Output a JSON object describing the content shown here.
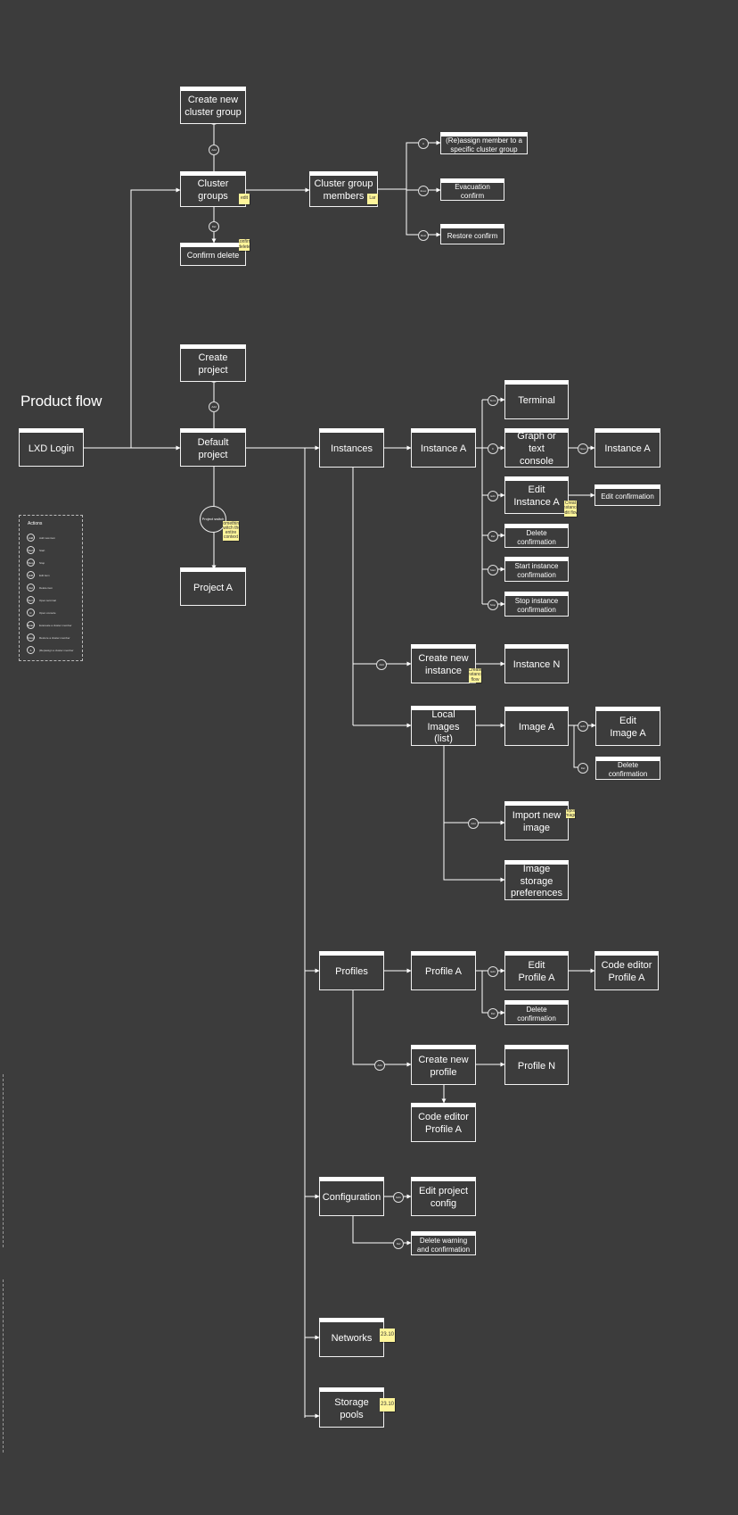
{
  "title": "Product flow",
  "nodes": {
    "create_cluster_group": "Create new\ncluster group",
    "cluster_groups": "Cluster\ngroups",
    "confirm_delete": "Confirm delete",
    "cluster_group_members": "Cluster group\nmembers",
    "reassign_member": "(Re)assign member to a\nspecific cluster group",
    "evacuation_confirm": "Evacuation confirm",
    "restore_confirm": "Restore confirm",
    "create_project": "Create\nproject",
    "lxd_login": "LXD Login",
    "default_project": "Default\nproject",
    "project_a": "Project A",
    "instances": "Instances",
    "instance_a": "Instance A",
    "terminal": "Terminal",
    "graph_console": "Graph or text\nconsole",
    "instance_a_console": "Instance A",
    "edit_instance_a": "Edit\nInstance A",
    "edit_confirmation": "Edit confirmation",
    "delete_confirmation_instance": "Delete confirmation",
    "start_instance_confirmation": "Start instance\nconfirmation",
    "stop_instance_confirmation": "Stop instance\nconfirmation",
    "create_new_instance": "Create new\ninstance",
    "instance_n": "Instance N",
    "local_images": "Local Images\n(list)",
    "image_a": "Image A",
    "edit_image_a": "Edit\nImage A",
    "delete_confirmation_image": "Delete confirmation",
    "import_new_image": "Import new\nimage",
    "image_storage_preferences": "Image storage\npreferences",
    "profiles": "Profiles",
    "profile_a": "Profile A",
    "edit_profile_a": "Edit\nProfile A",
    "code_editor_profile_a": "Code editor\nProfile A",
    "delete_confirmation_profile": "Delete confirmation",
    "create_new_profile": "Create new\nprofile",
    "profile_n": "Profile N",
    "code_editor_profile_a_2": "Code editor\nProfile A",
    "configuration": "Configuration",
    "edit_project_config": "Edit project\nconfig",
    "delete_warning": "Delete warning\nand confirmation",
    "networks": "Networks",
    "storage_pools": "Storage\npools"
  },
  "project_switch_label": "Project\nswitch",
  "stickies": {
    "cluster_groups": "edit",
    "confirm_delete": "Confirm\ndelete",
    "cluster_group_members": "Lar",
    "project_switch": "Something\nswitch the\nentire\ncontext",
    "edit_instance_a": "Creat\ninstance\nedit\nflow",
    "create_new_instance": "Create\ninstance\nflow",
    "import_new_image": "Import\nimage",
    "networks": "23.10",
    "storage_pools": "23.10"
  },
  "badges": {
    "to_create_cluster_group": "Add",
    "to_confirm_delete": "Del",
    "to_reassign": "A",
    "to_evacuate": "Evac",
    "to_restore": "Rest",
    "to_create_project": "Add",
    "to_terminal": "Term",
    "to_graph_console": "C",
    "to_instance_console": "Open",
    "to_edit_instance": "Edit",
    "to_delete_instance": "Del",
    "to_start_instance": "Start",
    "to_stop_instance": "Stop",
    "to_create_instance": "Add",
    "to_edit_image": "Edit",
    "to_delete_image": "Del",
    "to_import_image": "Add",
    "to_edit_profile": "Edit",
    "to_delete_profile": "Del",
    "to_create_profile": "Add",
    "to_edit_config": "Edit",
    "to_delete_config": "Del"
  },
  "legend": {
    "title": "Actions",
    "items": [
      {
        "icon": "Add",
        "label": "Add new item"
      },
      {
        "icon": "Start",
        "label": "Start"
      },
      {
        "icon": "Stop",
        "label": "Stop"
      },
      {
        "icon": "Edit",
        "label": "Edit item"
      },
      {
        "icon": "Del",
        "label": "Delete item"
      },
      {
        "icon": "Term",
        "label": "Open terminal"
      },
      {
        "icon": "C",
        "label": "Open console"
      },
      {
        "icon": "Evac",
        "label": "Evacuate a cluster member"
      },
      {
        "icon": "Rest",
        "label": "Restore a cluster member"
      },
      {
        "icon": "A",
        "label": "(Re)assign a cluster member"
      }
    ]
  },
  "colors": {
    "background": "#3c3c3c",
    "line": "#ffffff",
    "sticky": "#fff59a"
  }
}
